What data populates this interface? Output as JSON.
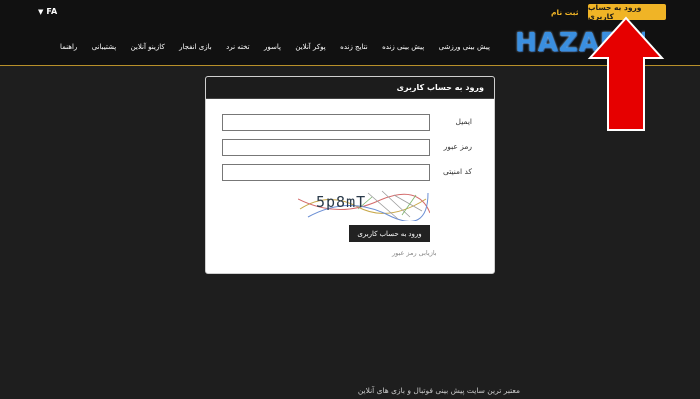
{
  "header": {
    "language": "FA",
    "login_button": "ورود به حساب کاربری",
    "register_link": "ثبت نام",
    "logo_text": "HAZARFE"
  },
  "nav": {
    "items": [
      "پیش بینی ورزشی",
      "پیش بینی زنده",
      "نتایج زنده",
      "پوکر آنلاین",
      "پاسور",
      "تخته نرد",
      "بازی انفجار",
      "کازینو آنلاین",
      "پشتیبانی",
      "راهنما"
    ]
  },
  "login_card": {
    "title": "ورود به حساب کاربری",
    "email_label": "ایمیل",
    "email_value": "",
    "password_label": "رمز عبور",
    "password_value": "",
    "captcha_label": "کد امنیتی",
    "captcha_value": "",
    "captcha_text": "5p8mT",
    "submit_label": "ورود به حساب کاربری",
    "forgot_label": "بازیابی رمز عبور"
  },
  "footer": {
    "text": "معتبر ترین سایت پیش بینی فوتبال و بازی های آنلاین"
  },
  "colors": {
    "accent": "#f0b426",
    "annotation_arrow": "#e60000",
    "background": "#1e1e1e"
  },
  "icons": {
    "lang_caret": "caret-down-icon",
    "annotation": "arrow-up-icon"
  }
}
